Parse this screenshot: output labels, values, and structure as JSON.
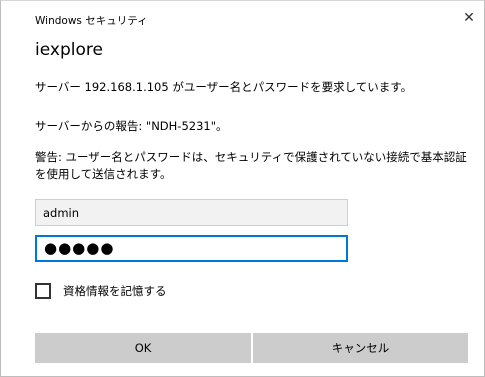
{
  "window": {
    "title": "Windows セキュリティ",
    "close_glyph": "✕"
  },
  "app_name": "iexplore",
  "messages": {
    "request": "サーバー 192.168.1.105 がユーザー名とパスワードを要求しています。",
    "report": "サーバーからの報告: \"NDH-5231\"。",
    "warning": "警告: ユーザー名とパスワードは、セキュリティで保護されていない接続で基本認証を使用して送信されます。"
  },
  "form": {
    "username_value": "admin",
    "password_display": "●●●●●",
    "remember_label": "資格情報を記憶する",
    "remember_checked": false
  },
  "buttons": {
    "ok_label": "OK",
    "cancel_label": "キャンセル"
  },
  "colors": {
    "focus_border": "#0078d7",
    "button_bg": "#cccccc",
    "readonly_field_bg": "#f2f2f2"
  },
  "icons": {
    "close": "close-icon"
  }
}
